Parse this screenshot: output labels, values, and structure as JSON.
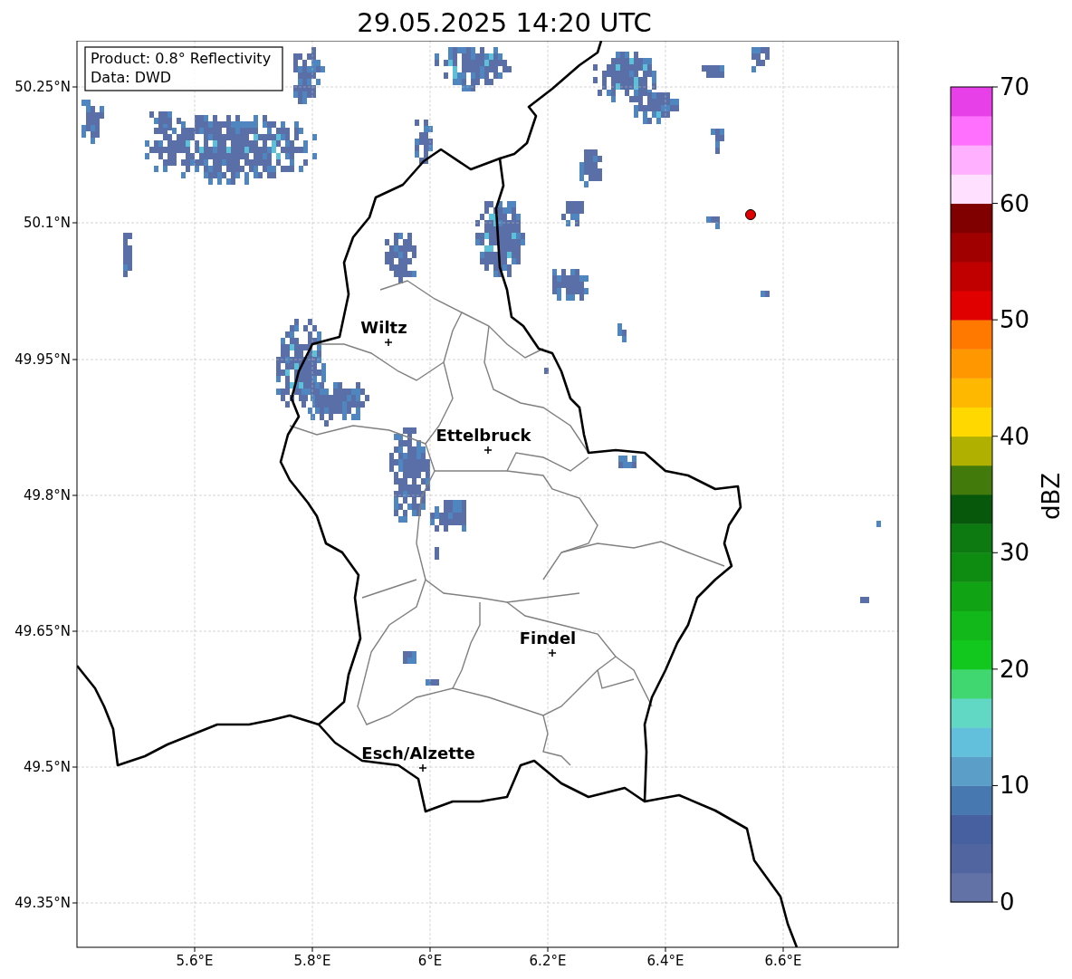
{
  "title": "29.05.2025 14:20 UTC",
  "info_box": [
    "Product: 0.8° Reflectivity",
    "Data: DWD"
  ],
  "map": {
    "lat_ticks": [
      "50.25°N",
      "50.1°N",
      "49.95°N",
      "49.8°N",
      "49.65°N",
      "49.5°N",
      "49.35°N"
    ],
    "lon_ticks": [
      "5.6°E",
      "5.8°E",
      "6°E",
      "6.2°E",
      "6.4°E",
      "6.6°E"
    ],
    "cities": [
      {
        "name": "Wiltz"
      },
      {
        "name": "Ettelbruck"
      },
      {
        "name": "Findel"
      },
      {
        "name": "Esch/Alzette"
      }
    ]
  },
  "colorbar": {
    "label": "dBZ",
    "ticks": [
      "70",
      "60",
      "50",
      "40",
      "30",
      "20",
      "10",
      "0"
    ],
    "segments": [
      {
        "color": "#6272a6"
      },
      {
        "color": "#5166a0"
      },
      {
        "color": "#4660a0"
      },
      {
        "color": "#4878b0"
      },
      {
        "color": "#5b9fc8"
      },
      {
        "color": "#62c0dc"
      },
      {
        "color": "#60d8c4"
      },
      {
        "color": "#40d670"
      },
      {
        "color": "#12c81e"
      },
      {
        "color": "#12b81a"
      },
      {
        "color": "#10a314"
      },
      {
        "color": "#0e8c12"
      },
      {
        "color": "#0c7a10"
      },
      {
        "color": "#08580c"
      },
      {
        "color": "#437a0c"
      },
      {
        "color": "#b0b000"
      },
      {
        "color": "#ffd800"
      },
      {
        "color": "#ffb800"
      },
      {
        "color": "#ff9800"
      },
      {
        "color": "#ff7800"
      },
      {
        "color": "#e00000"
      },
      {
        "color": "#c00000"
      },
      {
        "color": "#a00000"
      },
      {
        "color": "#800000"
      },
      {
        "color": "#ffe0ff"
      },
      {
        "color": "#ffb0ff"
      },
      {
        "color": "#ff70ff"
      },
      {
        "color": "#e840e8"
      }
    ]
  }
}
